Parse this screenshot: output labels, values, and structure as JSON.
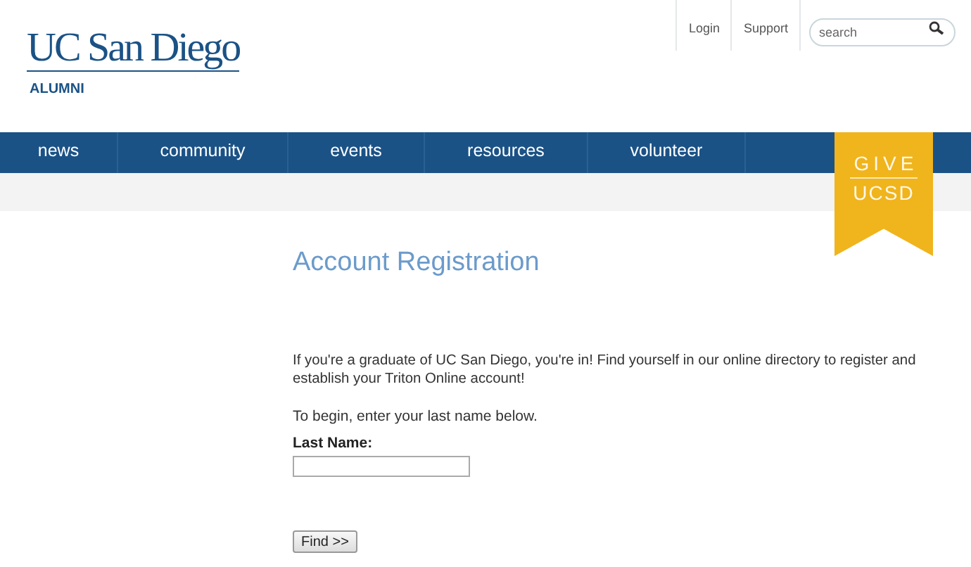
{
  "logo": {
    "wordmark": "UC San Diego",
    "subtitle": "ALUMNI"
  },
  "utility_links": [
    "Login",
    "Support"
  ],
  "search": {
    "placeholder": "search"
  },
  "nav": [
    {
      "label": "news"
    },
    {
      "label": "community"
    },
    {
      "label": "events"
    },
    {
      "label": "resources"
    },
    {
      "label": "volunteer"
    }
  ],
  "give": {
    "line_1": "GIVE",
    "line_2": "UCSD"
  },
  "title": "Account Registration",
  "intro": "If you're a graduate of UC San Diego, you're in! Find yourself in our online directory to register and establish your Triton Online account!",
  "instruction": "To begin, enter your last name below.",
  "field": {
    "label": "Last Name:"
  },
  "button": "Find >>"
}
